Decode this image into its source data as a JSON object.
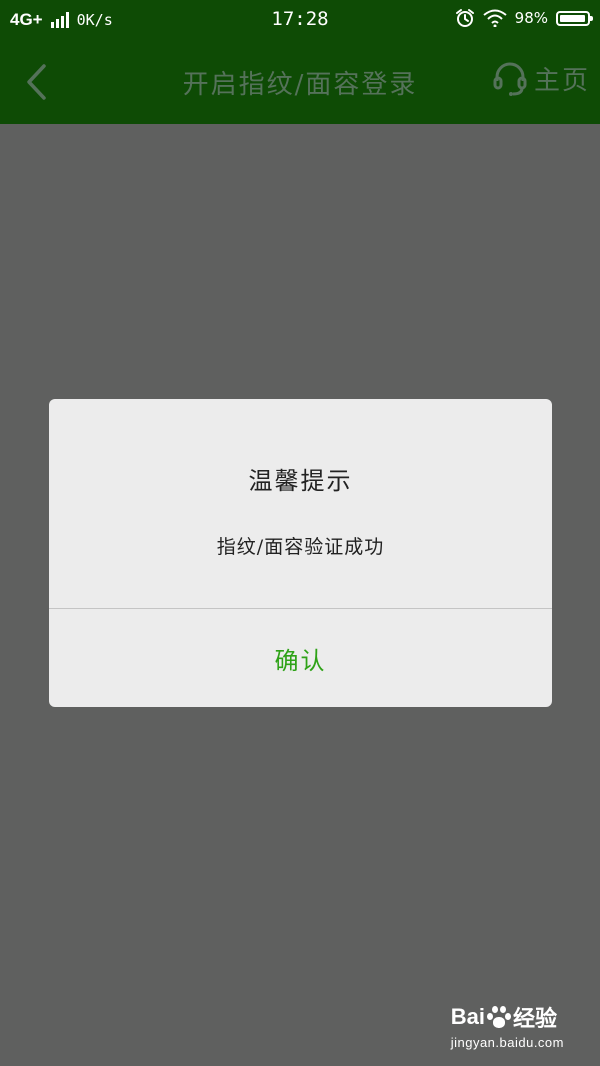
{
  "status_bar": {
    "network": "4G+",
    "speed": "0K/s",
    "time": "17:28",
    "battery_text": "98%",
    "battery_level": 0.98
  },
  "nav": {
    "title": "开启指纹/面容登录",
    "home_label": "主页",
    "icons": {
      "back": "chevron-left-icon",
      "home": "headset-icon"
    }
  },
  "dialog": {
    "title": "温馨提示",
    "message": "指纹/面容验证成功",
    "confirm_label": "确认"
  },
  "watermark": {
    "brand_prefix": "Bai",
    "brand_suffix": "经验",
    "url": "jingyan.baidu.com"
  },
  "colors": {
    "header_bg": "#0e4b05",
    "overlay_bg": "#5f605f",
    "dialog_bg": "#ececec",
    "accent_green": "#2ea217",
    "nav_text": "#55725a"
  }
}
